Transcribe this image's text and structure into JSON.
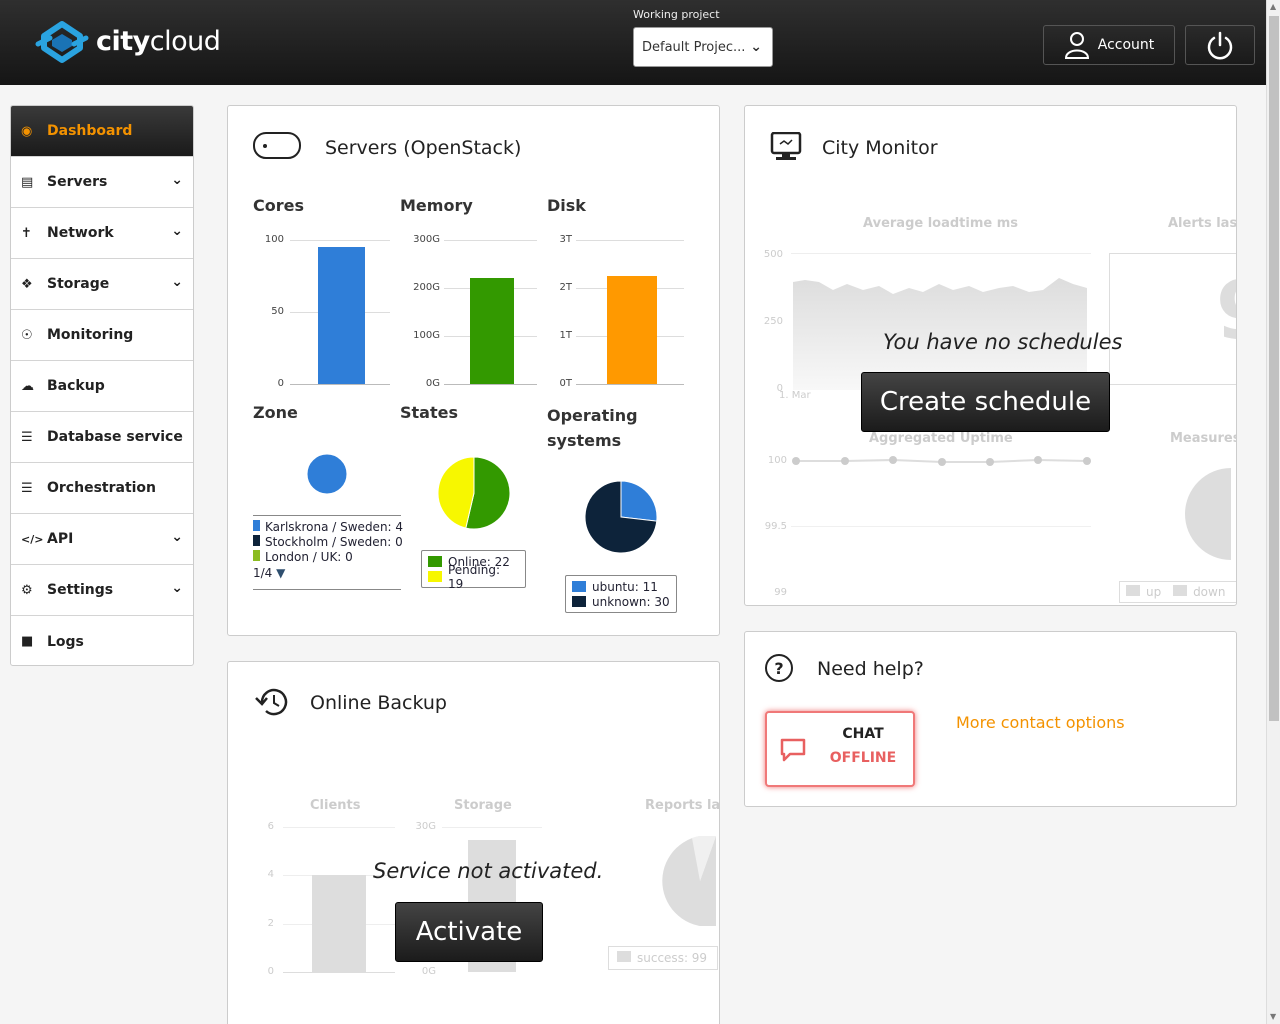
{
  "header": {
    "brand_bold": "city",
    "brand_light": "cloud",
    "working_project_label": "Working project",
    "project_value": "Default Projec...",
    "account_label": "Account"
  },
  "sidebar": {
    "items": [
      {
        "label": "Dashboard"
      },
      {
        "label": "Servers"
      },
      {
        "label": "Network"
      },
      {
        "label": "Storage"
      },
      {
        "label": "Monitoring"
      },
      {
        "label": "Backup"
      },
      {
        "label": "Database service"
      },
      {
        "label": "Orchestration"
      },
      {
        "label": "API"
      },
      {
        "label": "Settings"
      },
      {
        "label": "Logs"
      }
    ]
  },
  "servers": {
    "title": "Servers (OpenStack)",
    "cores": {
      "label": "Cores",
      "ticks": [
        "100",
        "50",
        "0"
      ]
    },
    "memory": {
      "label": "Memory",
      "ticks": [
        "300G",
        "200G",
        "100G",
        "0G"
      ]
    },
    "disk": {
      "label": "Disk",
      "ticks": [
        "3T",
        "2T",
        "1T",
        "0T"
      ]
    },
    "zone": {
      "label": "Zone",
      "legend": [
        "Karlskrona / Sweden: 4",
        "Stockholm / Sweden: 0",
        "London / UK: 0"
      ],
      "pager": "1/4"
    },
    "states": {
      "label": "States",
      "legend": [
        "Online: 22",
        "Pending: 19"
      ]
    },
    "os": {
      "label_1": "Operating",
      "label_2": "systems",
      "legend": [
        "ubuntu: 11",
        "unknown: 30"
      ]
    }
  },
  "monitor": {
    "title": "City Monitor",
    "avg_title": "Average loadtime ms",
    "alerts_title": "Alerts las",
    "avg_ticks": [
      "500",
      "250",
      "0"
    ],
    "avg_date": "1. Mar",
    "no_schedules": "You have no schedules",
    "create_schedule": "Create schedule",
    "uptime_title": "Aggregated Uptime",
    "measures_title": "Measures",
    "uptime_ticks": [
      "100",
      "99.5",
      "99"
    ],
    "legend_up": "up",
    "legend_down": "down"
  },
  "help": {
    "title": "Need help?",
    "chat_label": "CHAT",
    "chat_status": "OFFLINE",
    "more_contact": "More contact options"
  },
  "backup": {
    "title": "Online Backup",
    "clients_title": "Clients",
    "storage_title": "Storage",
    "reports_title": "Reports las",
    "clients_ticks": [
      "6",
      "4",
      "2",
      "0"
    ],
    "storage_ticks": [
      "30G",
      "0G"
    ],
    "not_activated": "Service not activated.",
    "activate": "Activate",
    "success_legend": "success: 99"
  },
  "chart_data": [
    {
      "type": "bar",
      "title": "Cores",
      "categories": [
        ""
      ],
      "values": [
        95
      ],
      "ylim": [
        0,
        100
      ]
    },
    {
      "type": "bar",
      "title": "Memory",
      "categories": [
        ""
      ],
      "values": [
        220
      ],
      "ylim": [
        0,
        300
      ],
      "unit": "G"
    },
    {
      "type": "bar",
      "title": "Disk",
      "categories": [
        ""
      ],
      "values": [
        2.25
      ],
      "ylim": [
        0,
        3
      ],
      "unit": "T"
    },
    {
      "type": "pie",
      "title": "Zone",
      "labels": [
        "Karlskrona / Sweden",
        "Stockholm / Sweden",
        "London / UK"
      ],
      "values": [
        4,
        0,
        0
      ]
    },
    {
      "type": "pie",
      "title": "States",
      "labels": [
        "Online",
        "Pending"
      ],
      "values": [
        22,
        19
      ]
    },
    {
      "type": "pie",
      "title": "Operating systems",
      "labels": [
        "ubuntu",
        "unknown"
      ],
      "values": [
        11,
        30
      ]
    }
  ],
  "colors": {
    "accent": "#f39200",
    "cores": "#2f7ed8",
    "memory": "#339900",
    "disk": "#ff9900",
    "navy": "#0d233a",
    "yellow": "#f7f700",
    "zone_green": "#8bbc21"
  }
}
